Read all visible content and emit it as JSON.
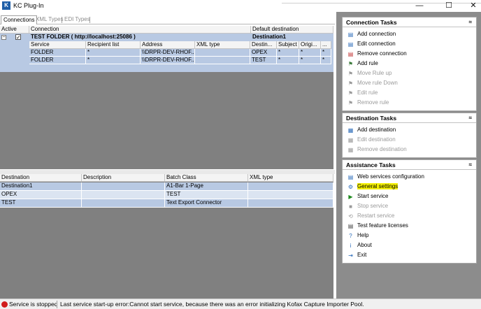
{
  "window": {
    "title": "KC Plug-In",
    "logo_letter": "K",
    "minimize": "—",
    "maximize": "☐",
    "close": "✕"
  },
  "tabs": [
    {
      "label": "Connections",
      "active": true
    },
    {
      "label": "XML Types",
      "active": false
    },
    {
      "label": "EDI Types",
      "active": false
    }
  ],
  "connections_grid": {
    "headers": {
      "active": "Active",
      "connection": "Connection",
      "default_destination": "Default destination"
    },
    "group": {
      "expand": "−",
      "checked": "✓",
      "name": "TEST FOLDER ( http://localhost:25086 )",
      "default_destination": "Destination1"
    },
    "sub_headers": [
      "Service",
      "Recipient list",
      "Address",
      "XML type",
      "Destin...",
      "Subject",
      "Origi...",
      "..."
    ],
    "rows": [
      [
        "FOLDER",
        "*",
        "\\\\DRPR-DEV-RHOF...",
        "",
        "OPEX",
        "*",
        "*",
        "*"
      ],
      [
        "FOLDER",
        "*",
        "\\\\DRPR-DEV-RHOF...",
        "",
        "TEST",
        "*",
        "*",
        "*"
      ]
    ]
  },
  "destinations_grid": {
    "headers": [
      "Destination",
      "Description",
      "Batch Class",
      "XML type"
    ],
    "rows": [
      [
        "Destination1",
        "",
        "A1-Bar 1-Page",
        ""
      ],
      [
        "OPEX",
        "",
        "TEST",
        ""
      ],
      [
        "TEST",
        "",
        "Text Export Connector",
        ""
      ]
    ]
  },
  "connection_tasks": {
    "title": "Connection Tasks",
    "items": [
      {
        "label": "Add connection",
        "icon": "add-connection-icon",
        "glyph": "▤",
        "color": "#2a6ab8",
        "enabled": true
      },
      {
        "label": "Edit connection",
        "icon": "edit-connection-icon",
        "glyph": "▤",
        "color": "#2a6ab8",
        "enabled": true
      },
      {
        "label": "Remove connection",
        "icon": "remove-connection-icon",
        "glyph": "▤",
        "color": "#c03030",
        "enabled": true
      },
      {
        "label": "Add rule",
        "icon": "add-rule-icon",
        "glyph": "⚑",
        "color": "#3b7a3b",
        "enabled": true
      },
      {
        "label": "Move Rule up",
        "icon": "move-rule-up-icon",
        "glyph": "⚑",
        "color": "#9a9a9a",
        "enabled": false
      },
      {
        "label": "Move rule Down",
        "icon": "move-rule-down-icon",
        "glyph": "⚑",
        "color": "#9a9a9a",
        "enabled": false
      },
      {
        "label": "Edit rule",
        "icon": "edit-rule-icon",
        "glyph": "⚑",
        "color": "#9a9a9a",
        "enabled": false
      },
      {
        "label": "Remove rule",
        "icon": "remove-rule-icon",
        "glyph": "⚑",
        "color": "#9a9a9a",
        "enabled": false
      }
    ]
  },
  "destination_tasks": {
    "title": "Destination Tasks",
    "items": [
      {
        "label": "Add destination",
        "icon": "add-destination-icon",
        "glyph": "▦",
        "color": "#2a6ab8",
        "enabled": true
      },
      {
        "label": "Edit destination",
        "icon": "edit-destination-icon",
        "glyph": "▦",
        "color": "#9a9a9a",
        "enabled": false
      },
      {
        "label": "Remove destination",
        "icon": "remove-destination-icon",
        "glyph": "▦",
        "color": "#9a9a9a",
        "enabled": false
      }
    ]
  },
  "assistance_tasks": {
    "title": "Assistance Tasks",
    "items": [
      {
        "label": "Web services configuration",
        "icon": "web-services-icon",
        "glyph": "▤",
        "color": "#2a6ab8",
        "enabled": true,
        "highlight": false
      },
      {
        "label": "General settings",
        "icon": "settings-icon",
        "glyph": "⚙",
        "color": "#2a6ab8",
        "enabled": true,
        "highlight": true
      },
      {
        "label": "Start service",
        "icon": "play-icon",
        "glyph": "▶",
        "color": "#1e8a1e",
        "enabled": true,
        "highlight": false
      },
      {
        "label": "Stop service",
        "icon": "stop-icon",
        "glyph": "■",
        "color": "#9a9a9a",
        "enabled": false,
        "highlight": false
      },
      {
        "label": "Restart service",
        "icon": "restart-icon",
        "glyph": "⟲",
        "color": "#9a9a9a",
        "enabled": false,
        "highlight": false
      },
      {
        "label": "Test feature licenses",
        "icon": "licenses-icon",
        "glyph": "▤",
        "color": "#444444",
        "enabled": true,
        "highlight": false
      },
      {
        "label": "Help",
        "icon": "help-icon",
        "glyph": "?",
        "color": "#2a6ab8",
        "enabled": true,
        "highlight": false
      },
      {
        "label": "About",
        "icon": "about-icon",
        "glyph": "i",
        "color": "#2a6ab8",
        "enabled": true,
        "highlight": false
      },
      {
        "label": "Exit",
        "icon": "exit-icon",
        "glyph": "⇥",
        "color": "#2a6ab8",
        "enabled": true,
        "highlight": false
      }
    ]
  },
  "collapse_glyph": "≈",
  "status": {
    "left": "Service is stopped",
    "message": "Last service start-up error:Cannot start service, because there was an error initializing Kofax Capture Importer Pool.",
    "indicator_color": "#d11c1c"
  }
}
